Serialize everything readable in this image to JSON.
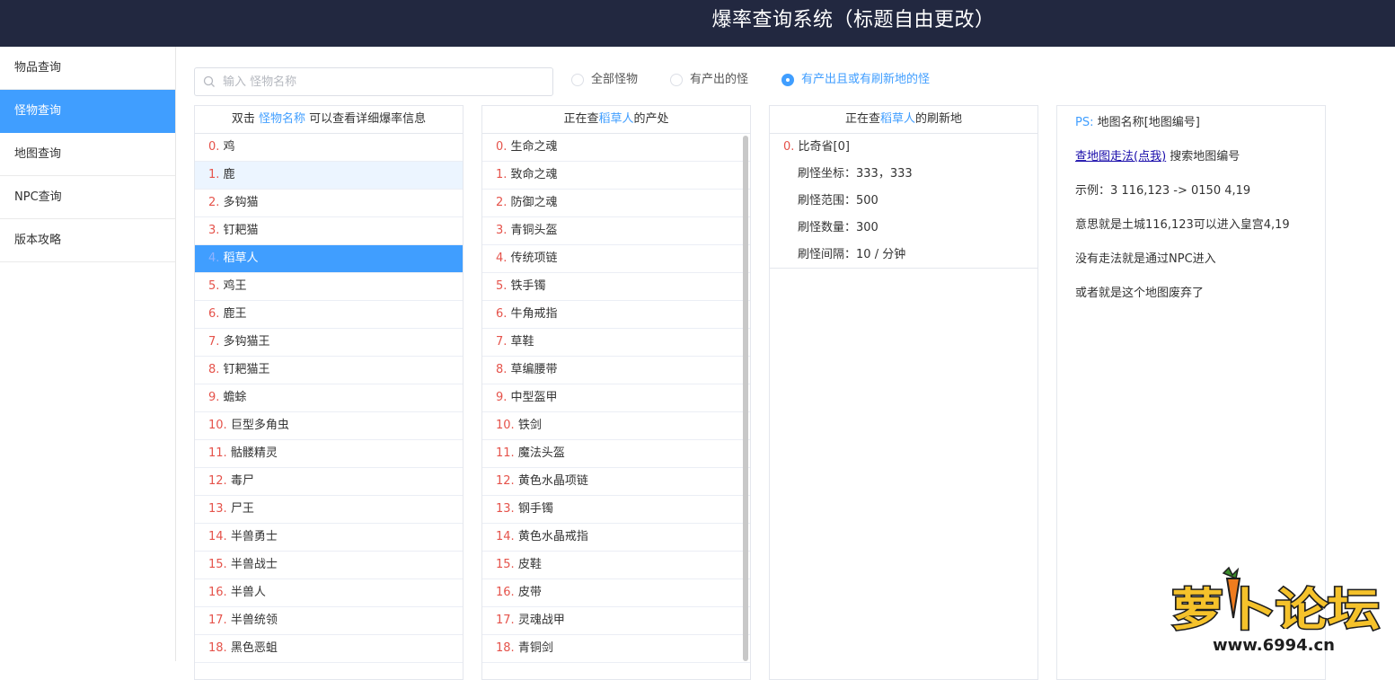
{
  "header": {
    "title": "爆率查询系统（标题自由更改）"
  },
  "sidebar": {
    "items": [
      {
        "label": "物品查询",
        "active": false
      },
      {
        "label": "怪物查询",
        "active": true
      },
      {
        "label": "地图查询",
        "active": false
      },
      {
        "label": "NPC查询",
        "active": false
      },
      {
        "label": "版本攻略",
        "active": false
      }
    ]
  },
  "search": {
    "placeholder": "输入 怪物名称",
    "value": ""
  },
  "filters": {
    "options": [
      {
        "label": "全部怪物",
        "checked": false
      },
      {
        "label": "有产出的怪",
        "checked": false
      },
      {
        "label": "有产出且或有刷新地的怪",
        "checked": true
      }
    ]
  },
  "monsters": {
    "header": {
      "pre": "双击 ",
      "highlight": "怪物名称",
      "post": " 可以查看详细爆率信息"
    },
    "selected_index": 4,
    "hover_index": 1,
    "items": [
      {
        "idx": "0.",
        "name": "鸡"
      },
      {
        "idx": "1.",
        "name": "鹿"
      },
      {
        "idx": "2.",
        "name": "多钩猫"
      },
      {
        "idx": "3.",
        "name": "钉耙猫"
      },
      {
        "idx": "4.",
        "name": "稻草人"
      },
      {
        "idx": "5.",
        "name": "鸡王"
      },
      {
        "idx": "6.",
        "name": "鹿王"
      },
      {
        "idx": "7.",
        "name": "多钩猫王"
      },
      {
        "idx": "8.",
        "name": "钉耙猫王"
      },
      {
        "idx": "9.",
        "name": "蟾蜍"
      },
      {
        "idx": "10.",
        "name": "巨型多角虫"
      },
      {
        "idx": "11.",
        "name": "骷髅精灵"
      },
      {
        "idx": "12.",
        "name": "毒尸"
      },
      {
        "idx": "13.",
        "name": "尸王"
      },
      {
        "idx": "14.",
        "name": "半兽勇士"
      },
      {
        "idx": "15.",
        "name": "半兽战士"
      },
      {
        "idx": "16.",
        "name": "半兽人"
      },
      {
        "idx": "17.",
        "name": "半兽统领"
      },
      {
        "idx": "18.",
        "name": "黑色恶蛆"
      }
    ]
  },
  "drops": {
    "header": {
      "pre": "正在查",
      "highlight": "稻草人",
      "post": "的产处"
    },
    "items": [
      {
        "idx": "0.",
        "name": "生命之魂"
      },
      {
        "idx": "1.",
        "name": "致命之魂"
      },
      {
        "idx": "2.",
        "name": "防御之魂"
      },
      {
        "idx": "3.",
        "name": "青铜头盔"
      },
      {
        "idx": "4.",
        "name": "传统项链"
      },
      {
        "idx": "5.",
        "name": "铁手镯"
      },
      {
        "idx": "6.",
        "name": "牛角戒指"
      },
      {
        "idx": "7.",
        "name": "草鞋"
      },
      {
        "idx": "8.",
        "name": "草编腰带"
      },
      {
        "idx": "9.",
        "name": "中型盔甲"
      },
      {
        "idx": "10.",
        "name": "铁剑"
      },
      {
        "idx": "11.",
        "name": "魔法头盔"
      },
      {
        "idx": "12.",
        "name": "黄色水晶项链"
      },
      {
        "idx": "13.",
        "name": "钢手镯"
      },
      {
        "idx": "14.",
        "name": "黄色水晶戒指"
      },
      {
        "idx": "15.",
        "name": "皮鞋"
      },
      {
        "idx": "16.",
        "name": "皮带"
      },
      {
        "idx": "17.",
        "name": "灵魂战甲"
      },
      {
        "idx": "18.",
        "name": "青铜剑"
      }
    ]
  },
  "spawn": {
    "header": {
      "pre": "正在查",
      "highlight": "稻草人",
      "post": "的刷新地"
    },
    "map": {
      "idx": "0.",
      "name": "比奇省[0]"
    },
    "details": [
      {
        "label": "刷怪坐标：",
        "value": "333，333"
      },
      {
        "label": "刷怪范围：",
        "value": "500"
      },
      {
        "label": "刷怪数量：",
        "value": "300"
      },
      {
        "label": "刷怪间隔：",
        "value": "10 / 分钟"
      }
    ]
  },
  "info": {
    "ps_label": "PS:",
    "ps_text": " 地图名称[地图编号]",
    "link_text": "查地图走法(点我)",
    "link_suffix": " 搜索地图编号",
    "example": "示例：3 116,123 -> 0150 4,19",
    "meaning": "意思就是土城116,123可以进入皇宫4,19",
    "npc_note": "没有走法就是通过NPC进入",
    "abandoned_note": "或者就是这个地图废弃了"
  },
  "watermark": {
    "brand": "萝卜论坛",
    "url": "www.6994.cn"
  },
  "colors": {
    "accent": "#409eff",
    "header_bg": "#222840",
    "index_red": "#e5534b"
  }
}
